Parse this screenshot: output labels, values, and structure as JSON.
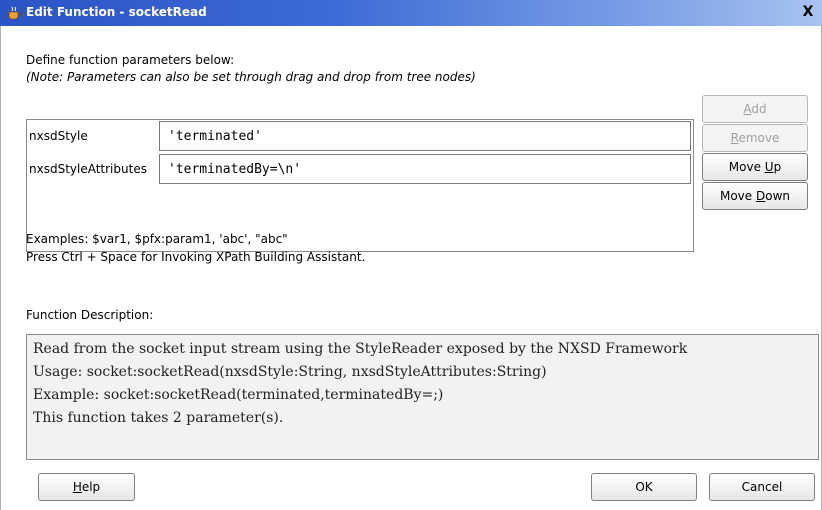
{
  "window": {
    "title": "Edit Function - socketRead",
    "close_label": "X"
  },
  "intro": {
    "line1": "Define function parameters below:",
    "line2": "(Note: Parameters can also be set through drag and drop from tree nodes)"
  },
  "parameters": [
    {
      "name": "nxsdStyle",
      "value": "'terminated'"
    },
    {
      "name": "nxsdStyleAttributes",
      "value": "'terminatedBy=\\n'"
    }
  ],
  "side_buttons": {
    "add": {
      "before": "",
      "mnemonic": "A",
      "after": "dd"
    },
    "remove": {
      "before": "",
      "mnemonic": "R",
      "after": "emove"
    },
    "move_up": {
      "before": "Move ",
      "mnemonic": "U",
      "after": "p"
    },
    "move_down": {
      "before": "Move ",
      "mnemonic": "D",
      "after": "own"
    }
  },
  "hints": {
    "examples": "Examples: $var1, $pfx:param1, 'abc', \"abc\"",
    "assist": "Press Ctrl + Space for Invoking XPath Building Assistant."
  },
  "description": {
    "label": "Function Description:",
    "lines": [
      "Read from the socket input stream using the StyleReader exposed by the NXSD Framework",
      "Usage: socket:socketRead(nxsdStyle:String, nxsdStyleAttributes:String)",
      "Example: socket:socketRead(terminated,terminatedBy=;)",
      "This function takes 2 parameter(s)."
    ]
  },
  "footer": {
    "help": {
      "mnemonic": "H",
      "after": "elp"
    },
    "ok": "OK",
    "cancel": "Cancel"
  }
}
